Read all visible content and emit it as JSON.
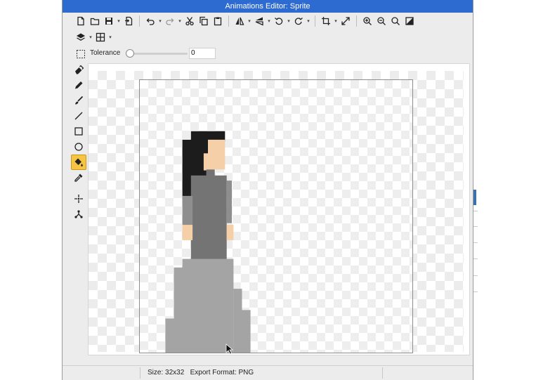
{
  "window": {
    "title": "Animations Editor: Sprite"
  },
  "toolbar": {
    "row1": [
      {
        "name": "new-file-icon"
      },
      {
        "name": "open-folder-icon"
      },
      {
        "name": "save-icon",
        "caret": true
      },
      {
        "name": "export-icon"
      },
      {
        "sep": true
      },
      {
        "name": "undo-icon",
        "caret": true
      },
      {
        "name": "redo-icon",
        "caret": true
      },
      {
        "name": "cut-icon"
      },
      {
        "name": "copy-icon"
      },
      {
        "name": "paste-icon"
      },
      {
        "sep": true
      },
      {
        "name": "flip-horizontal-icon",
        "caret": true
      },
      {
        "name": "flip-vertical-icon",
        "caret": true
      },
      {
        "name": "rotate-left-icon",
        "caret": true
      },
      {
        "name": "rotate-right-icon",
        "caret": true
      },
      {
        "sep": true
      },
      {
        "name": "crop-icon",
        "caret": true
      },
      {
        "name": "resize-icon"
      },
      {
        "sep": true
      },
      {
        "name": "zoom-in-icon"
      },
      {
        "name": "zoom-out-icon"
      },
      {
        "name": "zoom-fit-icon"
      },
      {
        "name": "background-toggle-icon"
      }
    ],
    "row2": [
      {
        "name": "layers-icon",
        "caret": true
      },
      {
        "name": "grid-icon",
        "caret": true
      }
    ]
  },
  "options": {
    "tolerance_label": "Tolerance",
    "tolerance_value": "0",
    "tolerance_fraction": 0.0
  },
  "tools": [
    {
      "name": "eraser-tool-icon"
    },
    {
      "name": "pencil-tool-icon"
    },
    {
      "name": "brush-tool-icon"
    },
    {
      "name": "line-tool-icon"
    },
    {
      "name": "rectangle-tool-icon"
    },
    {
      "name": "ellipse-tool-icon"
    },
    {
      "name": "fill-bucket-tool-icon",
      "active": true
    },
    {
      "name": "eyedropper-tool-icon"
    },
    {
      "gap": true
    },
    {
      "name": "origin-point-icon"
    },
    {
      "name": "skeleton-joint-icon"
    }
  ],
  "canvas": {
    "sprite_grid": 32,
    "colors": {
      "hair": "#1c1c1c",
      "skin": "#f5cfa8",
      "dress_dark": "#747474",
      "dress_mid": "#8e8e8e",
      "dress_light": "#a4a4a4"
    }
  },
  "status": {
    "text": "Size: 32x32   Export Format: PNG"
  }
}
